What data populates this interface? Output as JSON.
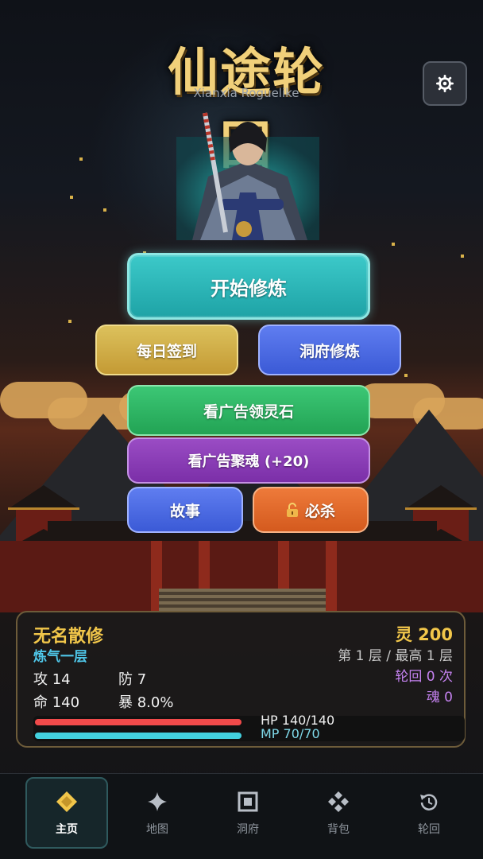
{
  "header": {
    "title": "仙途轮回",
    "subtitle": "Xianxia Roguelike",
    "settings_icon": "gear-icon"
  },
  "menu": {
    "start_label": "开始修炼",
    "daily_label": "每日签到",
    "cave_training_label": "洞府修炼",
    "ad_spirit_stone_label": "看广告领灵石",
    "ad_soul_label": "看广告聚魂 (+20)",
    "story_label": "故事",
    "ultimate_label": "必杀",
    "ultimate_icon": "lock-icon"
  },
  "player": {
    "name": "无名散修",
    "realm": "炼气一层",
    "attack": "攻 14",
    "defense": "防 7",
    "life": "命 140",
    "crit": "暴 8.0%",
    "spirit": "灵 200",
    "floor": "第 1 层 / 最高 1 层",
    "rebirth": "轮回 0 次",
    "soul": "魂 0",
    "hp_label": "HP 140/140",
    "mp_label": "MP 70/70",
    "hp_fraction": 1.0,
    "mp_fraction": 1.0
  },
  "nav": {
    "items": [
      {
        "label": "主页",
        "icon": "diamond-icon",
        "active": true
      },
      {
        "label": "地图",
        "icon": "sparkle-icon",
        "active": false
      },
      {
        "label": "洞府",
        "icon": "square-icon",
        "active": false
      },
      {
        "label": "背包",
        "icon": "cluster-icon",
        "active": false
      },
      {
        "label": "轮回",
        "icon": "cycle-icon",
        "active": false
      }
    ]
  },
  "colors": {
    "gold": "#f1c64a",
    "teal": "#1ea3a6",
    "purple": "#c582f0",
    "hp": "#f04a4a",
    "mp": "#43d0de"
  }
}
